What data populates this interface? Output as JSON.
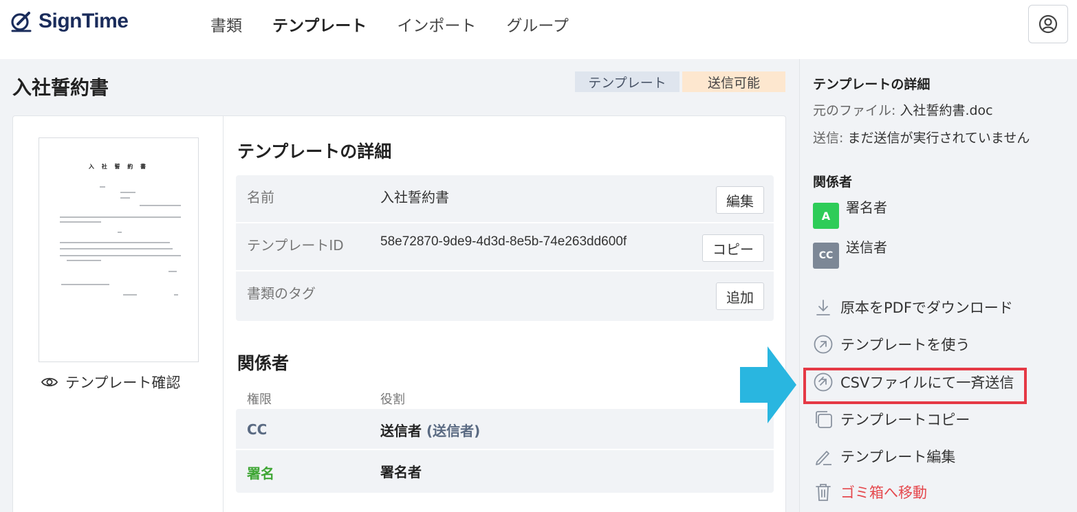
{
  "header": {
    "brand": "SignTime",
    "nav": [
      "書類",
      "テンプレート",
      "インポート",
      "グループ"
    ],
    "active_nav": 1,
    "user_icon": "user-circle-icon"
  },
  "page": {
    "title": "入社誓約書",
    "badges": {
      "template": "テンプレート",
      "status": "送信可能"
    }
  },
  "preview": {
    "doc_title": "入 社 誓 約 書",
    "link_label": "テンプレート確認",
    "link_icon": "eye-icon"
  },
  "details": {
    "heading": "テンプレートの詳細",
    "rows": [
      {
        "label": "名前",
        "value": "入社誓約書",
        "button": "編集"
      },
      {
        "label": "テンプレートID",
        "value": "58e72870-9de9-4d3d-8e5b-74e263dd600f",
        "button": "コピー"
      },
      {
        "label": "書類のタグ",
        "value": "",
        "button": "追加"
      }
    ]
  },
  "parties": {
    "heading": "関係者",
    "col_perm": "権限",
    "col_role": "役割",
    "rows": [
      {
        "perm": "CC",
        "role": "送信者",
        "role_sub": "(送信者)"
      },
      {
        "perm": "署名",
        "role": "署名者",
        "role_sub": ""
      }
    ]
  },
  "sidebar": {
    "detail_title": "テンプレートの詳細",
    "file_label": "元のファイル: ",
    "file_value": "入社誓約書.doc",
    "send_label": "送信: ",
    "send_value": "まだ送信が実行されていません",
    "parties_title": "関係者",
    "parties": [
      {
        "avatar": "A",
        "label": "署名者",
        "color": "#2ecc58"
      },
      {
        "avatar": "CC",
        "label": "送信者",
        "color": "#7c8796"
      }
    ],
    "actions": [
      {
        "label": "原本をPDFでダウンロード",
        "icon": "download-icon"
      },
      {
        "label": "テンプレートを使う",
        "icon": "arrow-up-right-circle-icon"
      },
      {
        "label": "CSVファイルにて一斉送信",
        "icon": "arrow-up-right-circle-icon"
      },
      {
        "label": "テンプレートコピー",
        "icon": "copy-icon"
      },
      {
        "label": "テンプレート編集",
        "icon": "pencil-icon"
      },
      {
        "label": "ゴミ箱へ移動",
        "icon": "trash-icon"
      }
    ]
  },
  "colors": {
    "brand": "#1a2c5b",
    "highlight": "#e53945",
    "arrow": "#29b6e0",
    "danger": "#e5484d",
    "green": "#3fa635"
  }
}
